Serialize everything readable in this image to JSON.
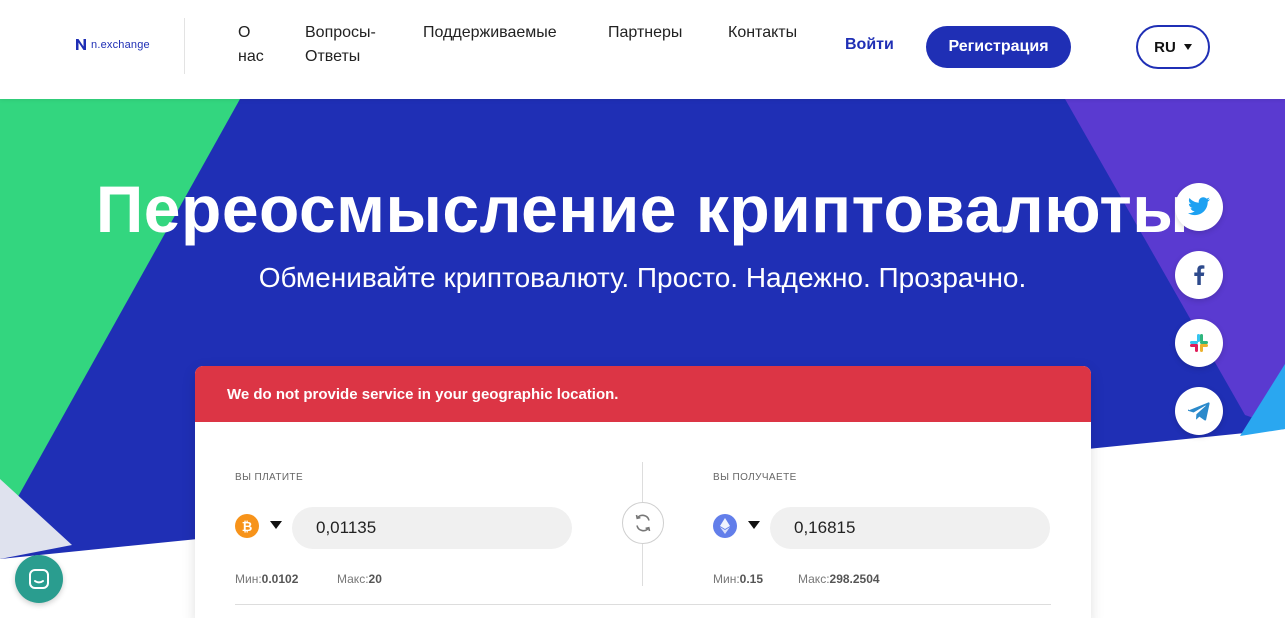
{
  "header": {
    "logo_text": "n.exchange",
    "nav": [
      "О нас",
      "Вопросы-Ответы",
      "Поддерживаемые",
      "Партнеры",
      "Контакты"
    ],
    "login": "Войти",
    "register": "Регистрация",
    "language": "RU"
  },
  "hero": {
    "title": "Переосмысление криптовалюты",
    "subtitle": "Обменивайте криптовалюту. Просто. Надежно. Прозрачно."
  },
  "socials": [
    "twitter-icon",
    "facebook-icon",
    "slack-icon",
    "telegram-icon"
  ],
  "exchange": {
    "alert": "We do not provide service in your geographic location.",
    "pay": {
      "label": "ВЫ ПЛАТИТЕ",
      "coin_icon": "bitcoin-icon",
      "amount": "0,01135",
      "min_label": "Мин:",
      "min": "0.0102",
      "max_label": "Макс:",
      "max": "20"
    },
    "receive": {
      "label": "ВЫ ПОЛУЧАЕТЕ",
      "coin_icon": "ethereum-icon",
      "amount": "0,16815",
      "min_label": "Мин:",
      "min": "0.15",
      "max_label": "Макс:",
      "max": "298.2504"
    }
  },
  "colors": {
    "brand": "#1f2fb5",
    "hero_blue": "#1f2fb5",
    "green": "#33d67f",
    "purple": "#5a3ad0",
    "alert": "#dc3545",
    "bitcoin": "#f7931a",
    "ethereum": "#627eea",
    "chat": "#2a9d8f"
  }
}
